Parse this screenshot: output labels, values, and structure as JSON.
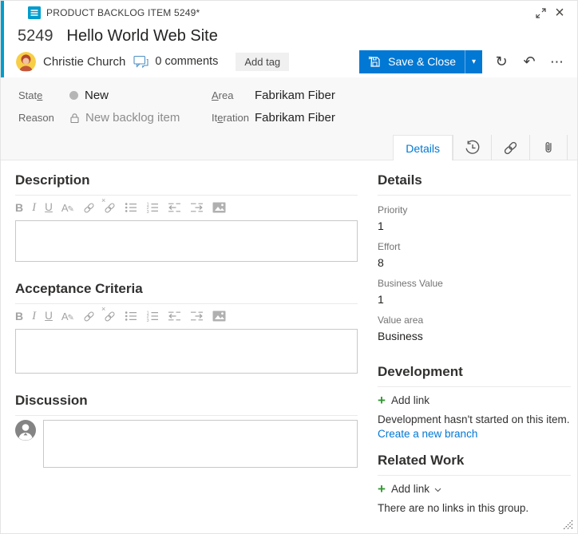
{
  "colors": {
    "accent_cyan": "#009ccc",
    "primary_blue": "#0078d4",
    "link_blue": "#0078d4",
    "green_plus": "#339933",
    "state_dot_gray": "#b5b5b5",
    "band_background": "#f8f8f8"
  },
  "window": {
    "caption": "PRODUCT BACKLOG ITEM 5249*",
    "close_glyph": "×"
  },
  "title": {
    "id": "5249",
    "text": "Hello World Web Site"
  },
  "command_bar": {
    "assignee": "Christie Church",
    "comments": "0 comments",
    "add_tag": "Add tag",
    "save_close": "Save & Close",
    "dropdown_glyph": "▾",
    "refresh_glyph": "↻",
    "undo_glyph": "↶",
    "more_glyph": "⋯"
  },
  "fields": {
    "state": {
      "label_pre": "Stat",
      "label_key": "e",
      "label_post": "",
      "value": "New"
    },
    "reason": {
      "label": "Reason",
      "value": "New backlog item"
    },
    "area": {
      "label_pre": "",
      "label_key": "A",
      "label_post": "rea",
      "value": "Fabrikam Fiber"
    },
    "iteration": {
      "label_pre": "It",
      "label_key": "e",
      "label_post": "ration",
      "value": "Fabrikam Fiber"
    }
  },
  "tabs": {
    "details": "Details"
  },
  "editor": {
    "bold": "B",
    "italic": "I",
    "underline": "U",
    "highlight": "A",
    "highlight_pen": "✎",
    "unlink_mark": "×"
  },
  "left": {
    "description_title": "Description",
    "acceptance_title": "Acceptance Criteria",
    "discussion_title": "Discussion"
  },
  "right": {
    "details_title": "Details",
    "fields": [
      {
        "label": "Priority",
        "value": "1"
      },
      {
        "label": "Effort",
        "value": "8"
      },
      {
        "label": "Business Value",
        "value": "1"
      },
      {
        "label": "Value area",
        "value": "Business"
      }
    ],
    "development_title": "Development",
    "development_add_link": "Add link",
    "development_status": "Development hasn't started on this item.",
    "development_link": "Create a new branch",
    "related_title": "Related Work",
    "related_add_link": "Add link",
    "related_empty": "There are no links in this group.",
    "plus_glyph": "+"
  }
}
